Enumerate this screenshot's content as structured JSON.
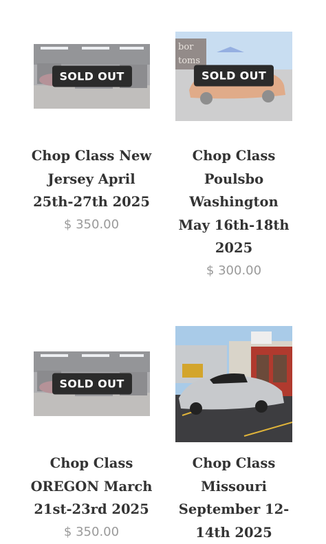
{
  "products": [
    {
      "title_lines": [
        "Chop Class New",
        "Jersey April",
        "25th-27th 2025"
      ],
      "price": "$ 350.00",
      "badge": "SOLD OUT",
      "image": "garage-shop-photo"
    },
    {
      "title_lines": [
        "Chop Class",
        "Poulsbo",
        "Washington",
        "May 16th-18th",
        "2025"
      ],
      "price": "$ 300.00",
      "badge": "SOLD OUT",
      "image": "orange-lowrider-photo"
    },
    {
      "title_lines": [
        "Chop Class",
        "OREGON March",
        "21st-23rd 2025"
      ],
      "price": "$ 350.00",
      "badge": "SOLD OUT",
      "image": "garage-shop-photo"
    },
    {
      "title_lines": [
        "Chop Class",
        "Missouri",
        "September 12-",
        "14th 2025"
      ],
      "image": "silver-custom-car-photo"
    }
  ]
}
